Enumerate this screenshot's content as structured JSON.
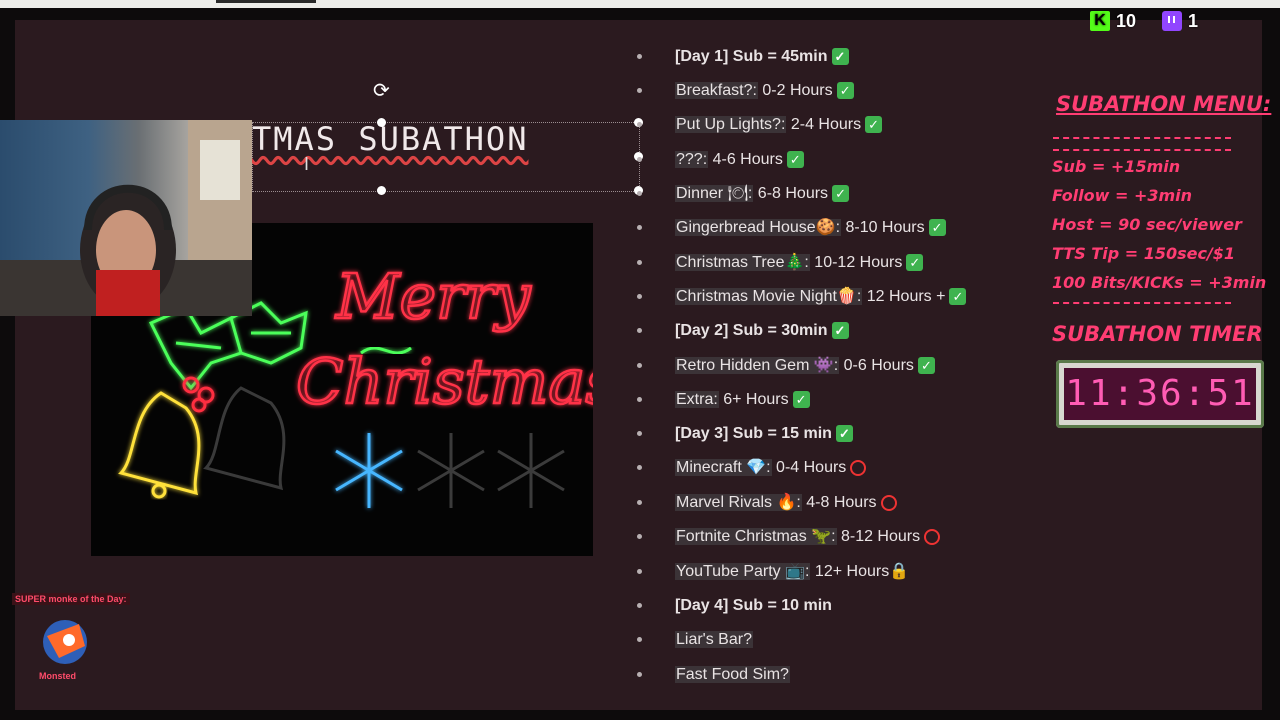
{
  "counters": {
    "kick_letter": "K",
    "kick_count": "10",
    "twitch_count": "1"
  },
  "slide": {
    "title_fragment": "TMAS SUBATHON"
  },
  "neon_sign": {
    "line1": "Merry",
    "line2": "Christmas"
  },
  "schedule": [
    {
      "text": "[Day 1] Sub = 45min",
      "day": true,
      "mark": "check",
      "hl": false
    },
    {
      "text": "Breakfast?:",
      "rest": " 0-2 Hours",
      "mark": "check",
      "hl": true
    },
    {
      "text": "Put Up Lights?:",
      "rest": " 2-4 Hours",
      "mark": "check",
      "hl": true
    },
    {
      "text": "???:",
      "rest": " 4-6 Hours",
      "mark": "check",
      "hl": true
    },
    {
      "text": "Dinner 🍽:",
      "rest": " 6-8 Hours",
      "mark": "check",
      "hl": true
    },
    {
      "text": "Gingerbread House🍪:",
      "rest": " 8-10 Hours",
      "mark": "check",
      "hl": true
    },
    {
      "text": "Christmas Tree🎄:",
      "rest": " 10-12 Hours",
      "mark": "check",
      "hl": true
    },
    {
      "text": "Christmas Movie Night🍿:",
      "rest": " 12 Hours +",
      "mark": "check",
      "hl": true
    },
    {
      "text": "[Day 2] Sub = 30min",
      "day": true,
      "mark": "check",
      "hl": false
    },
    {
      "text": "Retro Hidden Gem 👾:",
      "rest": " 0-6 Hours",
      "mark": "check",
      "hl": true
    },
    {
      "text": "Extra:",
      "rest": " 6+ Hours",
      "mark": "check",
      "hl": true
    },
    {
      "text": "[Day 3] Sub = 15 min",
      "day": true,
      "mark": "check",
      "hl": false
    },
    {
      "text": "Minecraft 💎:",
      "rest": " 0-4 Hours",
      "mark": "circle",
      "hl": true
    },
    {
      "text": "Marvel Rivals 🔥:",
      "rest": " 4-8 Hours",
      "mark": "circle",
      "hl": true
    },
    {
      "text": "Fortnite Christmas 🦖:",
      "rest": " 8-12 Hours",
      "mark": "circle",
      "hl": true
    },
    {
      "text": "YouTube Party 📺:",
      "rest": " 12+ Hours🔒",
      "mark": "none",
      "hl": true
    },
    {
      "text": "[Day 4] Sub = 10 min",
      "day": true,
      "mark": "none",
      "hl": false
    },
    {
      "text": "Liar's Bar?",
      "mark": "none",
      "hl": true
    },
    {
      "text": "Fast Food Sim?",
      "mark": "none",
      "hl": true
    }
  ],
  "menu": {
    "title": "SUBATHON MENU:",
    "lines": [
      "Sub = +15min",
      "Follow = +3min",
      "Host = 90 sec/viewer",
      "TTS Tip = 150sec/$1",
      "100 Bits/KICKs = +3min"
    ]
  },
  "timer": {
    "title": "SUBATHON TIMER",
    "value": "11:36:51"
  },
  "monke": {
    "label": "SUPER monke of the Day:",
    "name": "Monsted"
  },
  "colors": {
    "accent_pink": "#ff3d73",
    "kick_green": "#53fc18",
    "twitch_purple": "#9146ff",
    "check_green": "#3fb34f"
  }
}
